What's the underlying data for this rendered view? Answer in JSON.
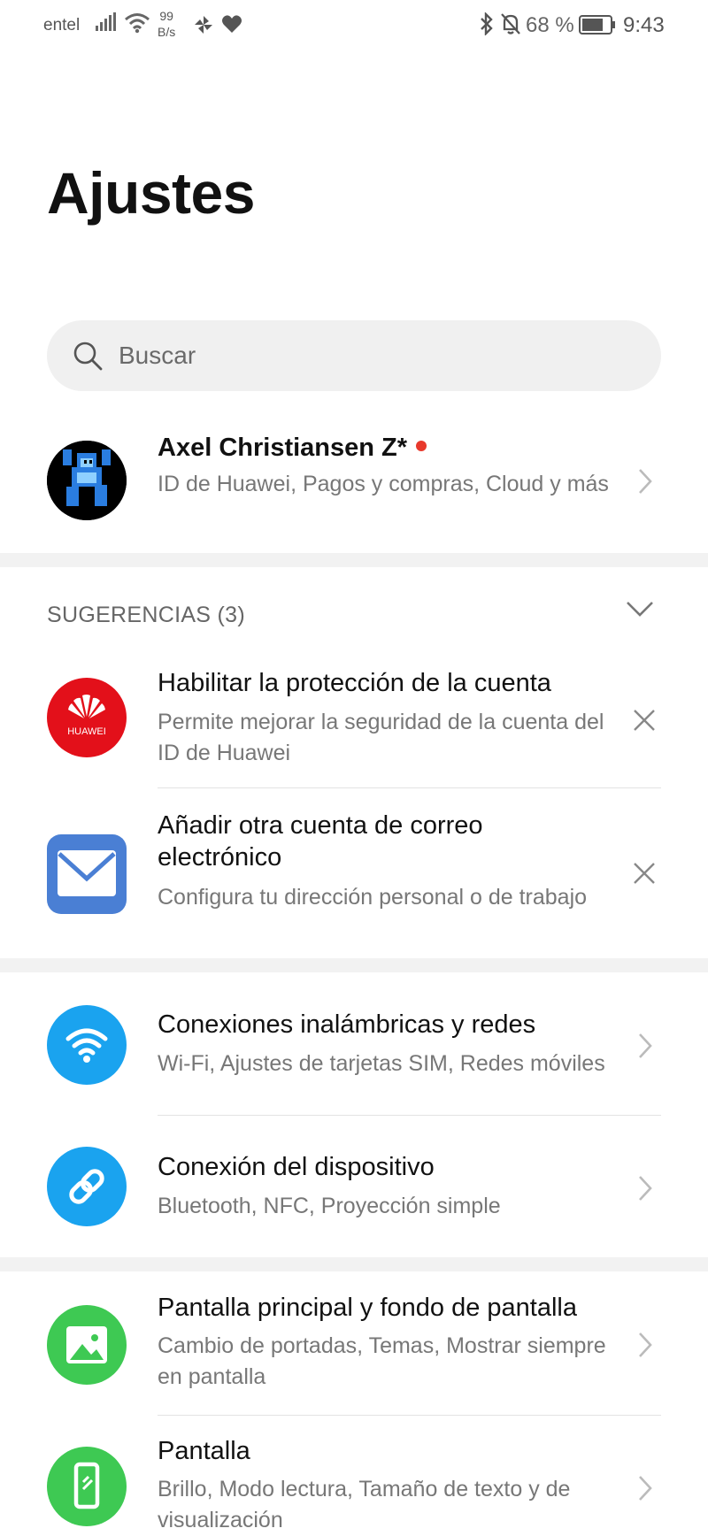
{
  "status_bar": {
    "carrier": "entel",
    "speed_value": "99",
    "speed_unit": "B/s",
    "battery_percent": "68 %",
    "time": "9:43"
  },
  "page": {
    "title": "Ajustes"
  },
  "search": {
    "placeholder": "Buscar"
  },
  "account": {
    "name": "Axel Christiansen Z*",
    "subtitle": "ID de Huawei, Pagos y compras, Cloud y más"
  },
  "suggestions": {
    "header": "SUGERENCIAS (3)",
    "items": [
      {
        "title": "Habilitar la protección de la cuenta",
        "subtitle": "Permite mejorar la seguridad de la cuenta del ID de Huawei",
        "icon": "huawei-logo-icon",
        "icon_text": "HUAWEI"
      },
      {
        "title": "Añadir otra cuenta de correo electrónico",
        "subtitle": "Configura tu dirección personal o de trabajo",
        "icon": "mail-icon"
      }
    ]
  },
  "settings": [
    {
      "title": "Conexiones inalámbricas y redes",
      "subtitle": "Wi-Fi, Ajustes de tarjetas SIM, Redes móviles",
      "icon": "wifi-icon",
      "color": "#1aa3ef"
    },
    {
      "title": "Conexión del dispositivo",
      "subtitle": "Bluetooth, NFC, Proyección simple",
      "icon": "link-icon",
      "color": "#1aa3ef"
    },
    {
      "title": "Pantalla principal y fondo de pantalla",
      "subtitle": "Cambio de portadas, Temas, Mostrar siempre en pantalla",
      "icon": "image-icon",
      "color": "#3ec953"
    },
    {
      "title": "Pantalla",
      "subtitle": "Brillo, Modo lectura, Tamaño de texto y de visualización",
      "icon": "phone-display-icon",
      "color": "#3ec953"
    }
  ],
  "colors": {
    "huawei_red": "#e3101a",
    "mail_blue": "#4a7fd4",
    "notification_dot": "#e8392c"
  }
}
